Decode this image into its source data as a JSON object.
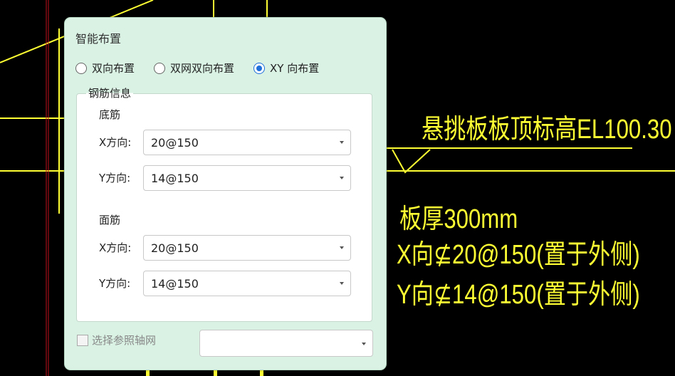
{
  "panel": {
    "title": "智能布置",
    "radios": [
      {
        "label": "双向布置",
        "checked": false
      },
      {
        "label": "双网双向布置",
        "checked": false
      },
      {
        "label": "XY 向布置",
        "checked": true
      }
    ],
    "group_title": "钢筋信息",
    "bottom": {
      "title": "底筋",
      "x_label": "X方向:",
      "x_value": "20@150",
      "y_label": "Y方向:",
      "y_value": "14@150"
    },
    "top": {
      "title": "面筋",
      "x_label": "X方向:",
      "x_value": "20@150",
      "y_label": "Y方向:",
      "y_value": "14@150"
    },
    "axis_checkbox_label": "选择参照轴网",
    "axis_select_value": ""
  },
  "cad": {
    "cantilever_elevation": "悬挑板板顶标高EL100.30",
    "thickness": "板厚300mm",
    "x_rebar": "X向⊈20@150(置于外侧)",
    "y_rebar": "Y向⊈14@150(置于外侧)",
    "line_color": "#ffff33"
  }
}
